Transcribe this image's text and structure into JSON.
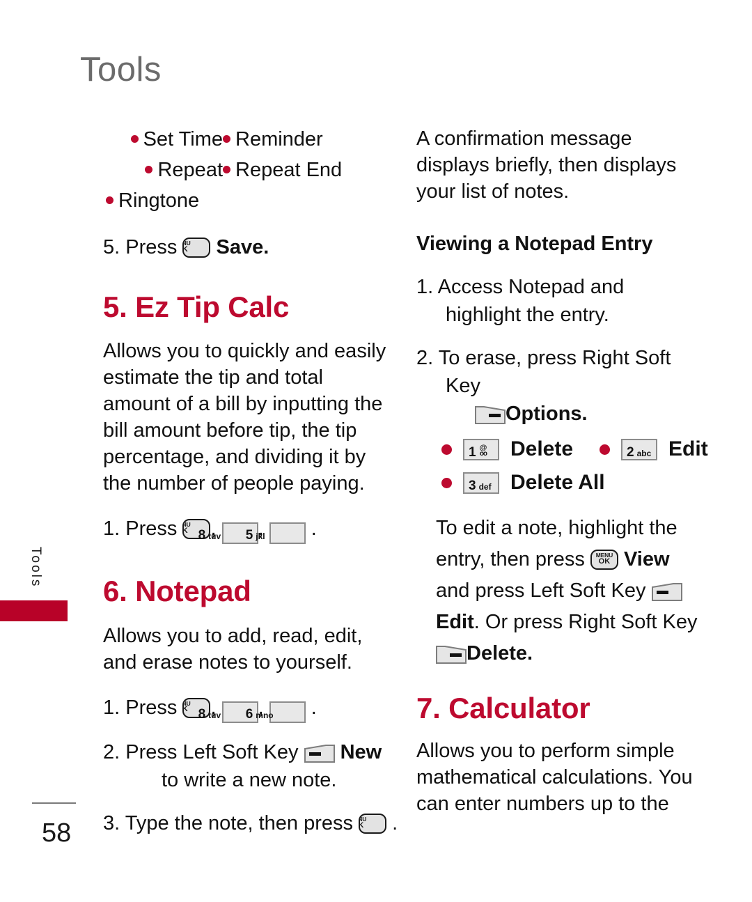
{
  "page": {
    "header": "Tools",
    "side_tab": "Tools",
    "number": "58",
    "accent_red": "#bd0a2f",
    "tab_red": "#b80228",
    "header_gray": "#6b6b6b"
  },
  "icons": {
    "menu_ok_line1": "MENU",
    "menu_ok_line2": "OK",
    "key_8": {
      "digit": "8",
      "letters": "tuv"
    },
    "key_5": {
      "digit": "5",
      "letters": "jkl"
    },
    "key_6": {
      "digit": "6",
      "letters": "mno"
    },
    "key_1": {
      "digit": "1",
      "letters": "@"
    },
    "key_2": {
      "digit": "2",
      "letters": "abc"
    },
    "key_3": {
      "digit": "3",
      "letters": "def"
    }
  },
  "left_column": {
    "bullets": [
      {
        "left": "Set Time",
        "right": "Reminder"
      },
      {
        "left": "Repeat",
        "right": "Repeat End"
      },
      {
        "left": "Ringtone",
        "right": ""
      }
    ],
    "save_step": {
      "number": "5.",
      "press": "Press",
      "label": "Save",
      "period": "."
    },
    "ez_tip_calc": {
      "title": "5. Ez Tip Calc",
      "body": "Allows you to quickly and easily estimate the tip and total amount of a bill by inputting the bill amount before tip, the tip percentage, and dividing it by the number of people paying.",
      "step": {
        "number": "1.",
        "press": "Press",
        "comma": ",",
        "period": "."
      }
    },
    "notepad": {
      "title": "6. Notepad",
      "body": "Allows you to add, read, edit, and erase notes to yourself.",
      "step1": {
        "number": "1.",
        "press": "Press",
        "comma": ",",
        "period": "."
      },
      "step2": {
        "number": "2.",
        "text_before": "Press Left Soft Key",
        "label": "New",
        "text_after": "to write a new note."
      },
      "step3": {
        "number": "3.",
        "text_before": "Type the note, then press",
        "period": "."
      }
    }
  },
  "right_column": {
    "confirmation": "A confirmation message displays briefly, then displays your list of notes.",
    "viewing_heading": "Viewing a Notepad Entry",
    "step1": {
      "number": "1.",
      "text": "Access Notepad and highlight the entry."
    },
    "step2": {
      "number": "2.",
      "text_before": "To erase, press Right Soft Key",
      "label": "Options",
      "period": "."
    },
    "options": [
      {
        "key": "key_1",
        "label": "Delete"
      },
      {
        "key": "key_2",
        "label": "Edit"
      },
      {
        "key": "key_3",
        "label": "Delete All"
      }
    ],
    "edit_note": {
      "part1": "To edit a note, highlight the entry, then press",
      "view_label": "View",
      "part2": "and press Left Soft Key",
      "edit_label": "Edit",
      "part3": ". Or press Right Soft Key",
      "delete_label": "Delete",
      "period": "."
    },
    "calculator": {
      "title": "7. Calculator",
      "body": "Allows you to perform simple mathematical calculations. You can enter numbers up to the"
    }
  }
}
